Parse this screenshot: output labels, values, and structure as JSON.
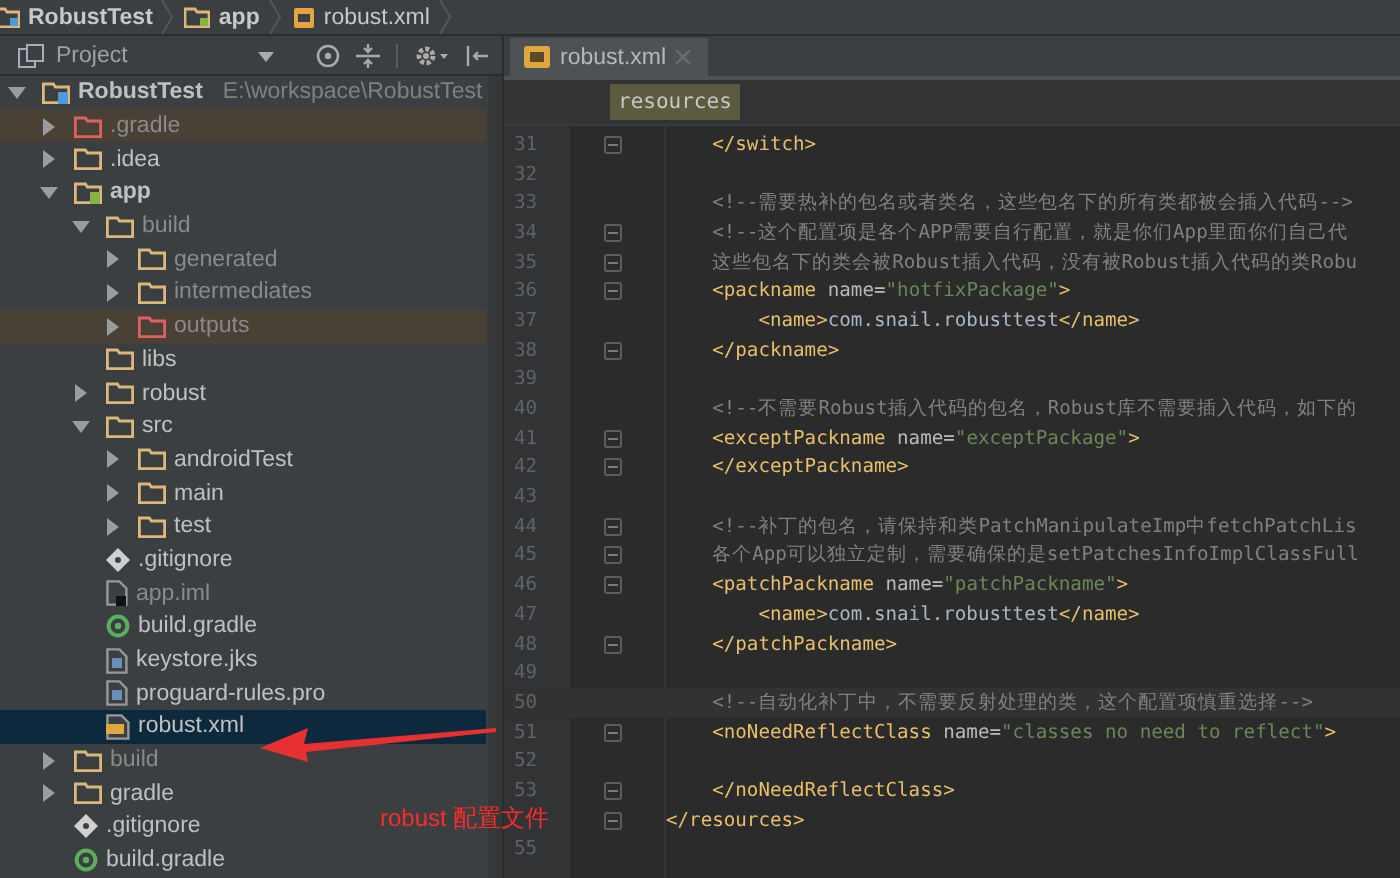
{
  "breadcrumb": [
    {
      "label": "RobustTest",
      "kind": "project"
    },
    {
      "label": "app",
      "kind": "module"
    },
    {
      "label": "robust.xml",
      "kind": "xml"
    }
  ],
  "project_panel": {
    "title": "Project",
    "tree": [
      {
        "label": "RobustTest",
        "path": "E:\\workspace\\RobustTest",
        "kind": "project",
        "expanded": true,
        "excluded": false,
        "ignored": false,
        "selected": false,
        "children": [
          {
            "label": ".gradle",
            "kind": "folder",
            "expanded": false,
            "excluded": true,
            "ignored": true,
            "selected": false
          },
          {
            "label": ".idea",
            "kind": "folder",
            "expanded": false,
            "excluded": false,
            "ignored": false,
            "selected": false
          },
          {
            "label": "app",
            "kind": "module",
            "expanded": true,
            "excluded": false,
            "ignored": false,
            "selected": false,
            "children": [
              {
                "label": "build",
                "kind": "folder",
                "expanded": true,
                "excluded": true,
                "ignored": false,
                "selected": false,
                "children": [
                  {
                    "label": "generated",
                    "kind": "folder",
                    "expanded": false,
                    "excluded": true,
                    "ignored": false,
                    "selected": false
                  },
                  {
                    "label": "intermediates",
                    "kind": "folder",
                    "expanded": false,
                    "excluded": true,
                    "ignored": false,
                    "selected": false
                  },
                  {
                    "label": "outputs",
                    "kind": "folder",
                    "expanded": false,
                    "excluded": true,
                    "ignored": true,
                    "selected": false
                  }
                ]
              },
              {
                "label": "libs",
                "kind": "leaf-folder",
                "excluded": false,
                "ignored": false,
                "selected": false
              },
              {
                "label": "robust",
                "kind": "folder",
                "expanded": false,
                "excluded": false,
                "ignored": false,
                "selected": false
              },
              {
                "label": "src",
                "kind": "folder",
                "expanded": true,
                "excluded": false,
                "ignored": false,
                "selected": false,
                "children": [
                  {
                    "label": "androidTest",
                    "kind": "folder",
                    "expanded": false,
                    "excluded": false,
                    "ignored": false,
                    "selected": false
                  },
                  {
                    "label": "main",
                    "kind": "folder",
                    "expanded": false,
                    "excluded": false,
                    "ignored": false,
                    "selected": false
                  },
                  {
                    "label": "test",
                    "kind": "folder",
                    "expanded": false,
                    "excluded": false,
                    "ignored": false,
                    "selected": false
                  }
                ]
              },
              {
                "label": ".gitignore",
                "kind": "git",
                "excluded": false,
                "ignored": false,
                "selected": false
              },
              {
                "label": "app.iml",
                "kind": "iml",
                "excluded": true,
                "ignored": false,
                "selected": false
              },
              {
                "label": "build.gradle",
                "kind": "gradle",
                "excluded": false,
                "ignored": false,
                "selected": false
              },
              {
                "label": "keystore.jks",
                "kind": "file",
                "excluded": false,
                "ignored": false,
                "selected": false
              },
              {
                "label": "proguard-rules.pro",
                "kind": "file",
                "excluded": false,
                "ignored": false,
                "selected": false
              },
              {
                "label": "robust.xml",
                "kind": "xml",
                "excluded": false,
                "ignored": false,
                "selected": true
              }
            ]
          },
          {
            "label": "build",
            "kind": "folder",
            "expanded": false,
            "excluded": true,
            "ignored": false,
            "selected": false
          },
          {
            "label": "gradle",
            "kind": "folder",
            "expanded": false,
            "excluded": false,
            "ignored": false,
            "selected": false
          },
          {
            "label": ".gitignore",
            "kind": "git",
            "excluded": false,
            "ignored": false,
            "selected": false
          },
          {
            "label": "build.gradle",
            "kind": "gradle",
            "excluded": false,
            "ignored": false,
            "selected": false
          }
        ]
      }
    ]
  },
  "editor": {
    "tabs": [
      {
        "label": "robust.xml",
        "selected": true
      }
    ],
    "path_chip": "resources",
    "lines": [
      {
        "num": "31",
        "fold": true,
        "current": false,
        "tokens": [
          {
            "kind": "tag",
            "text": "    </switch>"
          }
        ]
      },
      {
        "num": "32",
        "fold": false,
        "current": false
      },
      {
        "num": "33",
        "fold": false,
        "current": false,
        "tokens": [
          {
            "kind": "comment",
            "text": "    <!--需要热补的包名或者类名，这些包名下的所有类都被会插入代码-->"
          }
        ]
      },
      {
        "num": "34",
        "fold": true,
        "current": false,
        "tokens": [
          {
            "kind": "comment",
            "text": "    <!--这个配置项是各个APP需要自行配置，就是你们App里面你们自己代"
          }
        ]
      },
      {
        "num": "35",
        "fold": true,
        "current": false,
        "tokens": [
          {
            "kind": "comment",
            "text": "    这些包名下的类会被Robust插入代码，没有被Robust插入代码的类Robu"
          }
        ]
      },
      {
        "num": "36",
        "fold": true,
        "current": false,
        "tokens": [
          {
            "kind": "tag",
            "text": "    <packname "
          },
          {
            "kind": "attr",
            "text": "name="
          },
          {
            "kind": "string",
            "text": "\"hotfixPackage\""
          },
          {
            "kind": "tag",
            "text": ">"
          }
        ]
      },
      {
        "num": "37",
        "fold": false,
        "current": false,
        "tokens": [
          {
            "kind": "tag",
            "text": "        <name>"
          },
          {
            "kind": "text",
            "text": "com.snail.robusttest"
          },
          {
            "kind": "tag",
            "text": "</name>"
          }
        ]
      },
      {
        "num": "38",
        "fold": true,
        "current": false,
        "tokens": [
          {
            "kind": "tag",
            "text": "    </packname>"
          }
        ]
      },
      {
        "num": "39",
        "fold": false,
        "current": false
      },
      {
        "num": "40",
        "fold": false,
        "current": false,
        "tokens": [
          {
            "kind": "comment",
            "text": "    <!--不需要Robust插入代码的包名，Robust库不需要插入代码，如下的"
          }
        ]
      },
      {
        "num": "41",
        "fold": true,
        "current": false,
        "tokens": [
          {
            "kind": "tag",
            "text": "    <exceptPackname "
          },
          {
            "kind": "attr",
            "text": "name="
          },
          {
            "kind": "string",
            "text": "\"exceptPackage\""
          },
          {
            "kind": "tag",
            "text": ">"
          }
        ]
      },
      {
        "num": "42",
        "fold": true,
        "current": false,
        "tokens": [
          {
            "kind": "tag",
            "text": "    </exceptPackname>"
          }
        ]
      },
      {
        "num": "43",
        "fold": false,
        "current": false
      },
      {
        "num": "44",
        "fold": true,
        "current": false,
        "tokens": [
          {
            "kind": "comment",
            "text": "    <!--补丁的包名，请保持和类PatchManipulateImp中fetchPatchLis"
          }
        ]
      },
      {
        "num": "45",
        "fold": true,
        "current": false,
        "tokens": [
          {
            "kind": "comment",
            "text": "    各个App可以独立定制，需要确保的是setPatchesInfoImplClassFull"
          }
        ]
      },
      {
        "num": "46",
        "fold": true,
        "current": false,
        "tokens": [
          {
            "kind": "tag",
            "text": "    <patchPackname "
          },
          {
            "kind": "attr",
            "text": "name="
          },
          {
            "kind": "string",
            "text": "\"patchPackname\""
          },
          {
            "kind": "tag",
            "text": ">"
          }
        ]
      },
      {
        "num": "47",
        "fold": false,
        "current": false,
        "tokens": [
          {
            "kind": "tag",
            "text": "        <name>"
          },
          {
            "kind": "text",
            "text": "com.snail.robusttest"
          },
          {
            "kind": "tag",
            "text": "</name>"
          }
        ]
      },
      {
        "num": "48",
        "fold": true,
        "current": false,
        "tokens": [
          {
            "kind": "tag",
            "text": "    </patchPackname>"
          }
        ]
      },
      {
        "num": "49",
        "fold": false,
        "current": false
      },
      {
        "num": "50",
        "fold": false,
        "current": true,
        "tokens": [
          {
            "kind": "comment",
            "text": "    <!--自动化补丁中，不需要反射处理的类，这个配置项慎重选择-->"
          }
        ]
      },
      {
        "num": "51",
        "fold": true,
        "current": false,
        "tokens": [
          {
            "kind": "tag",
            "text": "    <noNeedReflectClass "
          },
          {
            "kind": "attr",
            "text": "name="
          },
          {
            "kind": "string",
            "text": "\"classes no need to reflect\""
          },
          {
            "kind": "tag",
            "text": ">"
          }
        ]
      },
      {
        "num": "52",
        "fold": false,
        "current": false
      },
      {
        "num": "53",
        "fold": true,
        "current": false,
        "tokens": [
          {
            "kind": "tag",
            "text": "    </noNeedReflectClass>"
          }
        ]
      },
      {
        "fold": true,
        "current": false,
        "tokens": [
          {
            "kind": "tag",
            "text": "</resources>"
          }
        ]
      },
      {
        "num": "55",
        "fold": false,
        "current": false
      }
    ]
  },
  "annotation": {
    "text": "robust 配置文件"
  }
}
